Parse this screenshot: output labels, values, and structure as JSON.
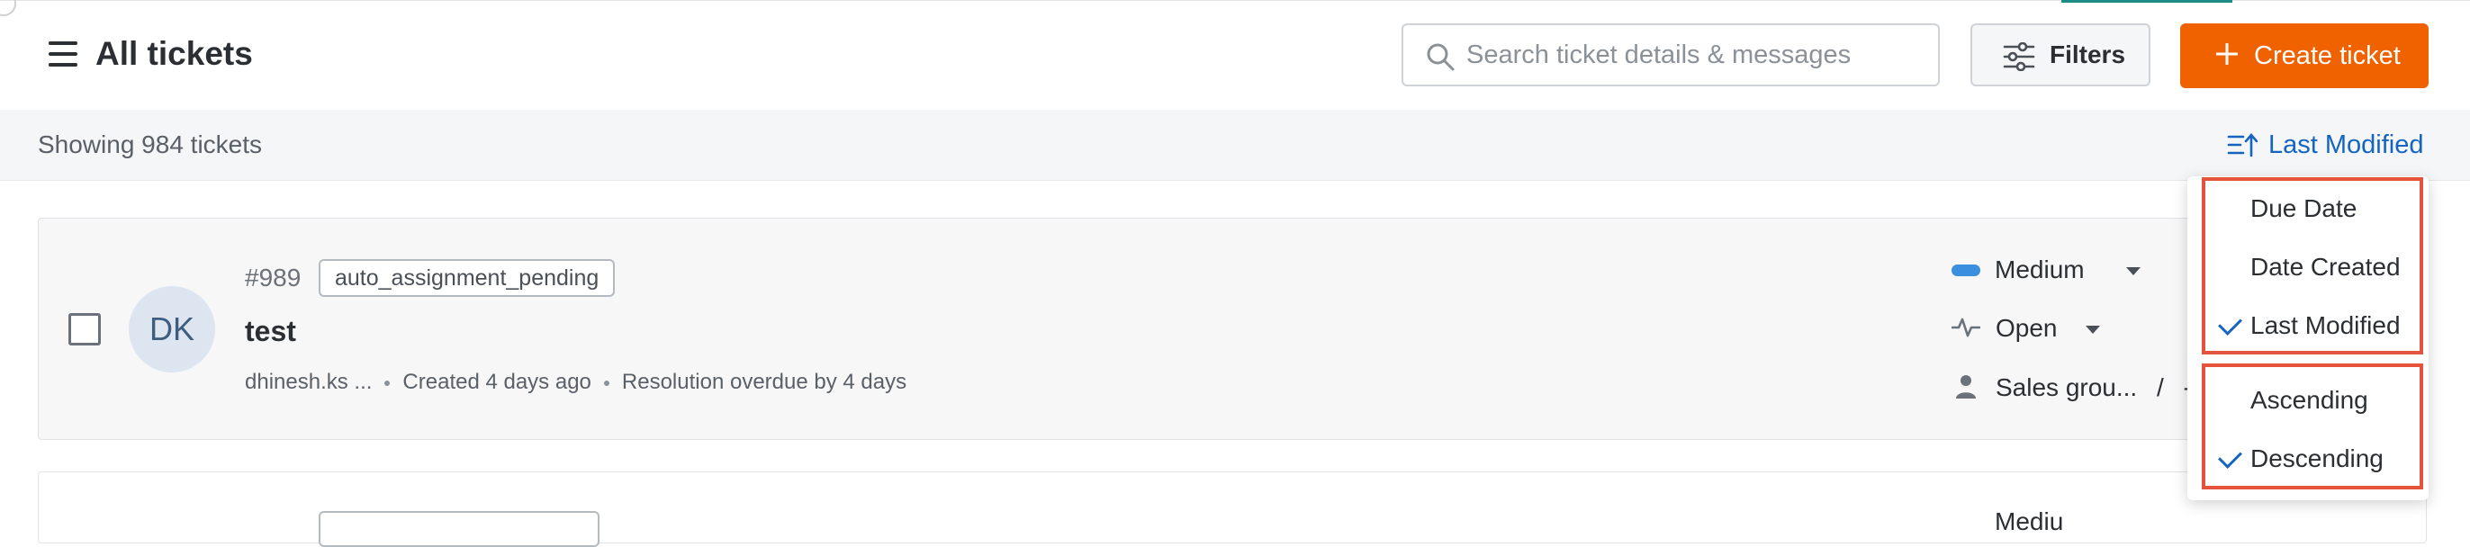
{
  "header": {
    "title": "All tickets",
    "search_placeholder": "Search ticket details & messages",
    "filters_label": "Filters",
    "create_label": "Create ticket",
    "icons": [
      "hamburger-icon",
      "search-icon",
      "filters-icon",
      "plus-icon"
    ],
    "accent_color": "#f06100"
  },
  "subbar": {
    "showing": "Showing 984 tickets",
    "sort_label": "Last Modified",
    "sort_icon": "sort-icon",
    "sort_color": "#1565c0"
  },
  "tickets": [
    {
      "initials": "DK",
      "id": "#989",
      "tag": "auto_assignment_pending",
      "title": "test",
      "requester": "dhinesh.ks ...",
      "created": "Created 4 days ago",
      "resolution": "Resolution overdue by 4 days",
      "priority": "Medium",
      "priority_color": "#3a8fde",
      "status": "Open",
      "group": "Sales grou...",
      "group_separator": "/",
      "agent": "--"
    },
    {
      "priority": "Mediu"
    }
  ],
  "sort_menu": {
    "fields": [
      {
        "label": "Due Date",
        "selected": false
      },
      {
        "label": "Date Created",
        "selected": false
      },
      {
        "label": "Last Modified",
        "selected": true
      }
    ],
    "orders": [
      {
        "label": "Ascending",
        "selected": false
      },
      {
        "label": "Descending",
        "selected": true
      }
    ],
    "highlight_color": "#e5533d"
  }
}
